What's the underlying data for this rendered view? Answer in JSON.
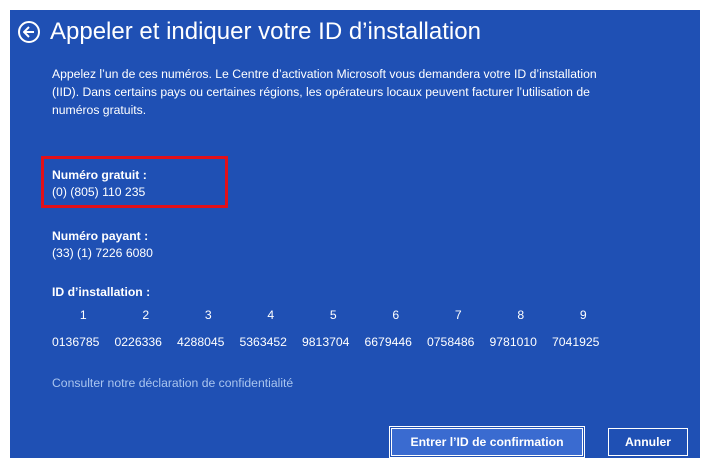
{
  "header": {
    "title": "Appeler et indiquer votre ID d’installation"
  },
  "description": "Appelez l’un de ces numéros. Le Centre d’activation Microsoft vous demandera votre ID d’installation\n(IID). Dans certains pays ou certaines régions, les opérateurs locaux peuvent facturer l’utilisation de\nnuméros gratuits.",
  "toll_free": {
    "label": "Numéro gratuit :",
    "number": "(0) (805) 110 235"
  },
  "paid": {
    "label": "Numéro payant :",
    "number": "(33) (1) 7226 6080"
  },
  "installation_id": {
    "label": "ID d’installation :",
    "indices": [
      "1",
      "2",
      "3",
      "4",
      "5",
      "6",
      "7",
      "8",
      "9"
    ],
    "groups": [
      "0136785",
      "0226336",
      "4288045",
      "5363452",
      "9813704",
      "6679446",
      "0758486",
      "9781010",
      "7041925"
    ]
  },
  "privacy_link": "Consulter notre déclaration de confidentialité",
  "buttons": {
    "confirm": "Entrer l’ID de confirmation",
    "cancel": "Annuler"
  },
  "colors": {
    "background": "#1f50b4",
    "highlight": "#e1101a",
    "link": "#a9c5ef"
  }
}
